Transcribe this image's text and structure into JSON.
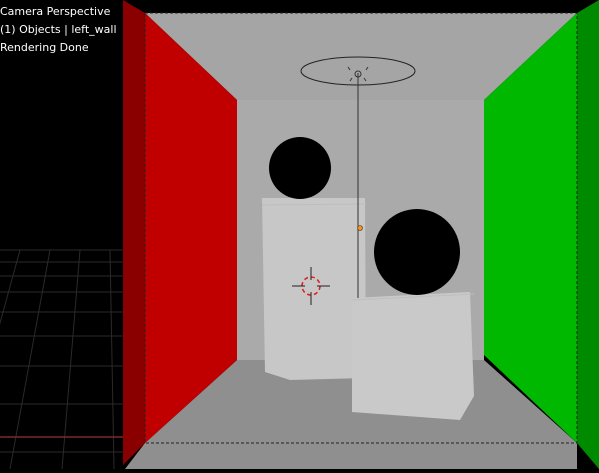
{
  "viewport": {
    "overlay": {
      "view_name": "Camera Perspective",
      "object_info": "(1) Objects | left_wall",
      "status": "Rendering Done"
    }
  },
  "colors": {
    "background": "#000000",
    "back_wall": "#a8a8a8",
    "floor_ceiling": "#8f8f8f",
    "left_wall": "#c00000",
    "left_wall_edge": "#8a0000",
    "right_wall": "#00b800",
    "right_wall_edge": "#008a00",
    "box": "#c7c7c7",
    "sphere": "#000000",
    "grid_line": "#2a2a2a",
    "x_axis": "#7a2a2a",
    "light_marker": "#e8932e"
  },
  "icons": {
    "area_light": "area-light-icon",
    "cursor": "3d-cursor-icon",
    "origin": "object-origin-icon"
  }
}
